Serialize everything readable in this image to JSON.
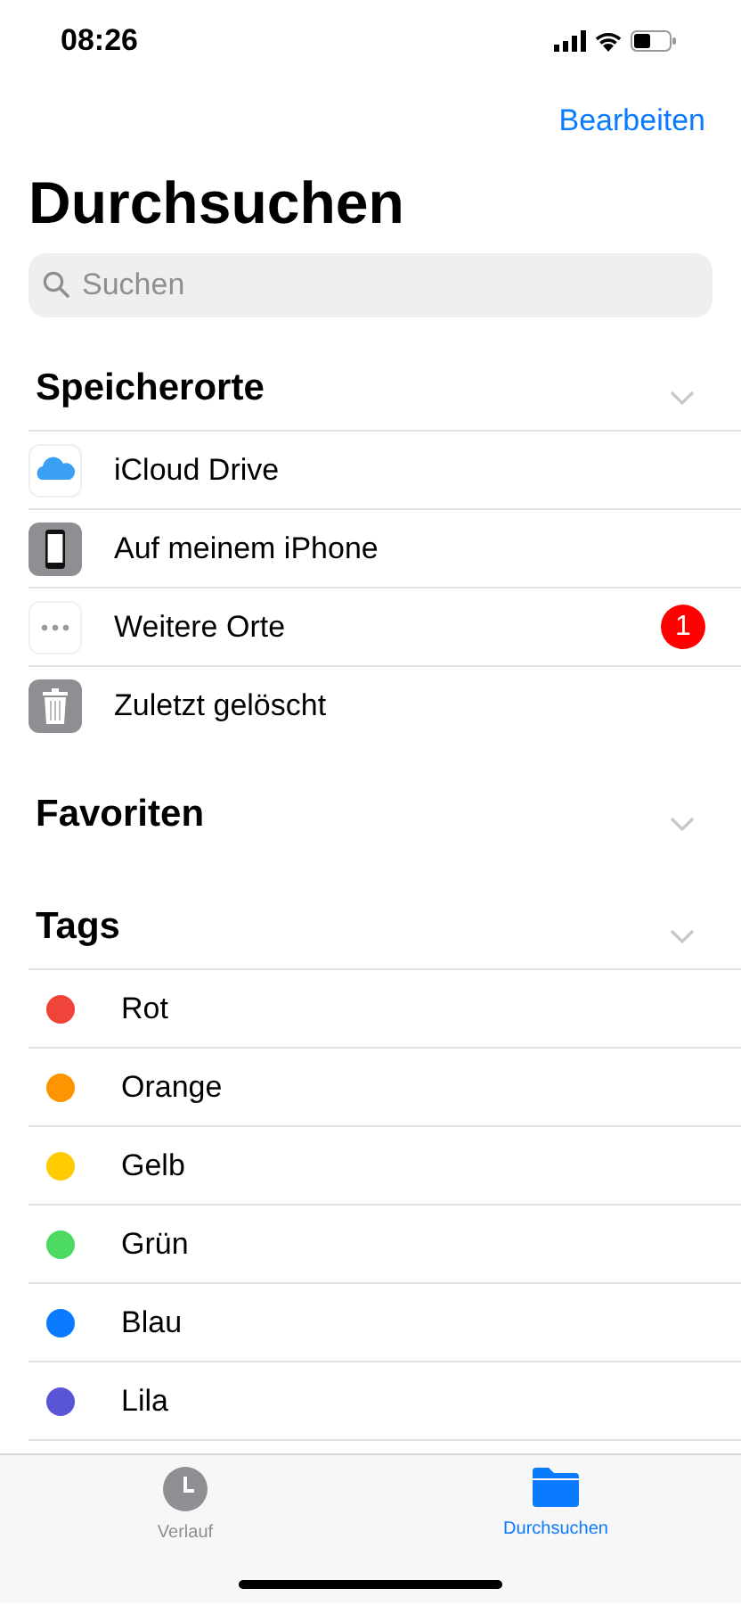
{
  "status_bar": {
    "time": "08:26"
  },
  "nav": {
    "edit": "Bearbeiten",
    "title": "Durchsuchen"
  },
  "search": {
    "placeholder": "Suchen"
  },
  "sections": [
    {
      "title": "Speicherorte",
      "items": [
        {
          "label": "iCloud Drive"
        },
        {
          "label": "Auf meinem iPhone"
        },
        {
          "label": "Weitere Orte",
          "badge": "1"
        },
        {
          "label": "Zuletzt gelöscht"
        }
      ]
    },
    {
      "title": "Favoriten"
    },
    {
      "title": "Tags",
      "tags": [
        {
          "label": "Rot",
          "color": "#f0433a"
        },
        {
          "label": "Orange",
          "color": "#fe9500"
        },
        {
          "label": "Gelb",
          "color": "#fecc00"
        },
        {
          "label": "Grün",
          "color": "#4cd964"
        },
        {
          "label": "Blau",
          "color": "#0a7aff"
        },
        {
          "label": "Lila",
          "color": "#5856d6"
        }
      ]
    }
  ],
  "tab_bar": [
    {
      "label": "Verlauf",
      "selected": false
    },
    {
      "label": "Durchsuchen",
      "selected": true
    }
  ]
}
